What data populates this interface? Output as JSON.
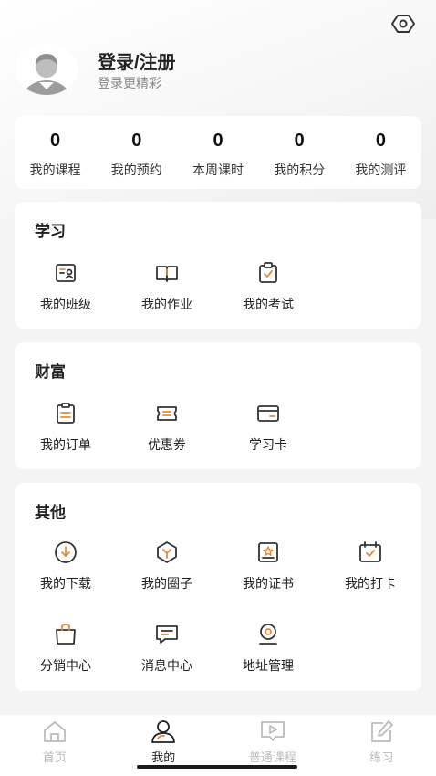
{
  "header": {
    "login_title": "登录/注册",
    "login_subtitle": "登录更精彩"
  },
  "stats": [
    {
      "value": "0",
      "label": "我的课程"
    },
    {
      "value": "0",
      "label": "我的预约"
    },
    {
      "value": "0",
      "label": "本周课时"
    },
    {
      "value": "0",
      "label": "我的积分"
    },
    {
      "value": "0",
      "label": "我的测评"
    }
  ],
  "study": {
    "title": "学习",
    "items": [
      {
        "label": "我的班级",
        "icon": "class-icon"
      },
      {
        "label": "我的作业",
        "icon": "book-icon"
      },
      {
        "label": "我的考试",
        "icon": "exam-icon"
      }
    ]
  },
  "wealth": {
    "title": "财富",
    "items": [
      {
        "label": "我的订单",
        "icon": "order-icon"
      },
      {
        "label": "优惠券",
        "icon": "coupon-icon"
      },
      {
        "label": "学习卡",
        "icon": "card-icon"
      }
    ]
  },
  "other": {
    "title": "其他",
    "items": [
      {
        "label": "我的下载",
        "icon": "download-icon"
      },
      {
        "label": "我的圈子",
        "icon": "circle-icon"
      },
      {
        "label": "我的证书",
        "icon": "certificate-icon"
      },
      {
        "label": "我的打卡",
        "icon": "checkin-icon"
      },
      {
        "label": "分销中心",
        "icon": "bag-icon"
      },
      {
        "label": "消息中心",
        "icon": "message-icon"
      },
      {
        "label": "地址管理",
        "icon": "location-icon"
      }
    ]
  },
  "tabs": [
    {
      "label": "首页",
      "icon": "home-icon",
      "active": false
    },
    {
      "label": "我的",
      "icon": "user-icon",
      "active": true
    },
    {
      "label": "普通课程",
      "icon": "course-icon",
      "active": false
    },
    {
      "label": "练习",
      "icon": "edit-icon",
      "active": false
    }
  ],
  "colors": {
    "accent": "#e8893a",
    "icon_stroke": "#333333",
    "tab_inactive": "#bbbbbb",
    "background": "#f4f4f4"
  }
}
